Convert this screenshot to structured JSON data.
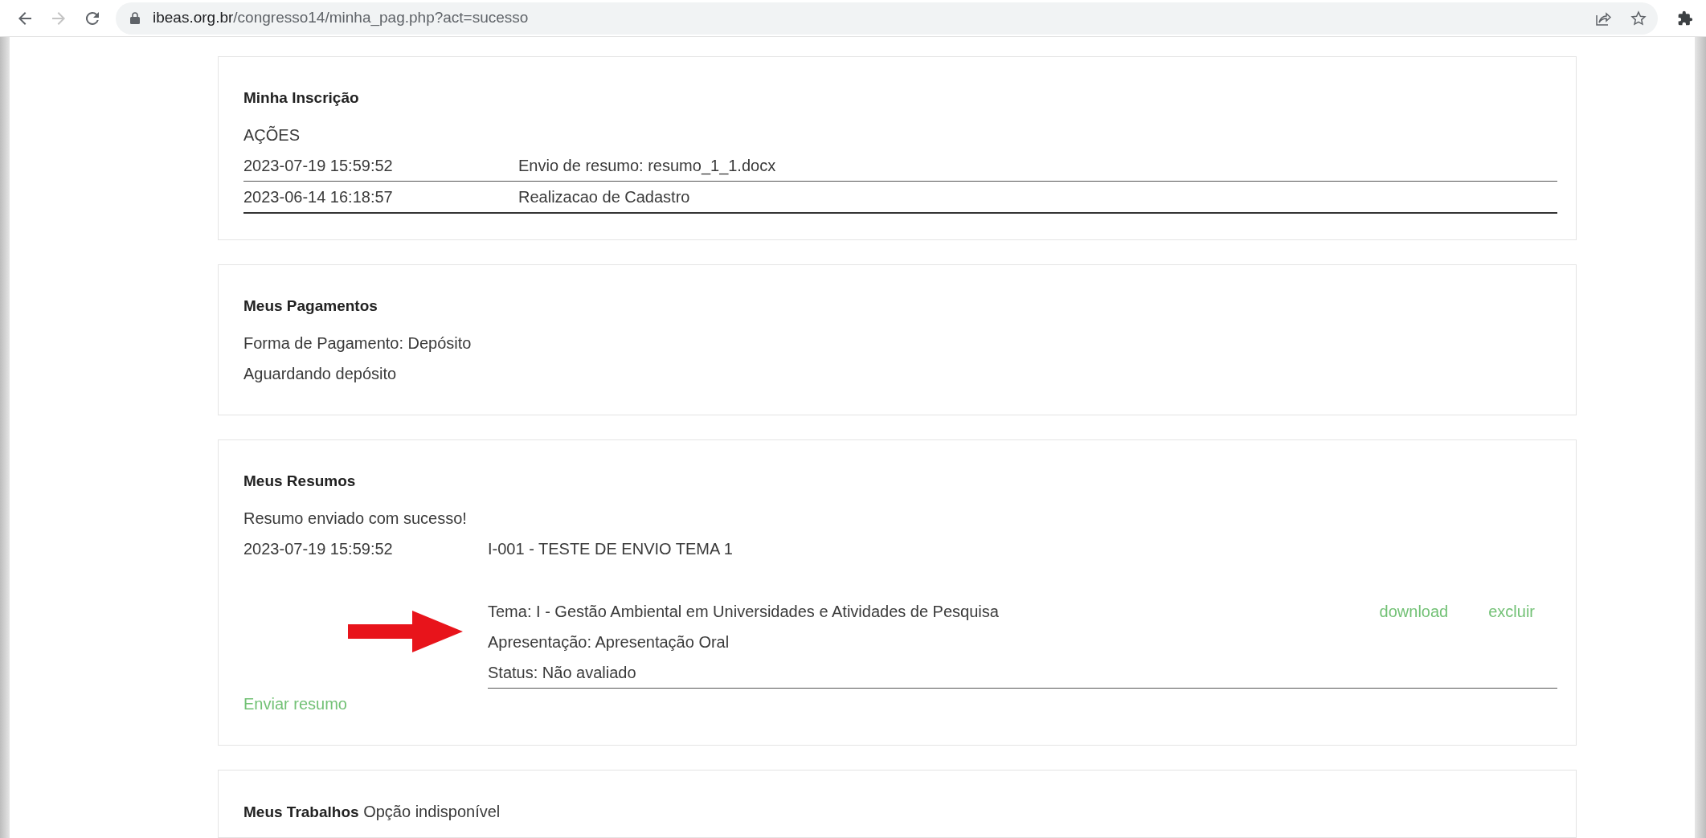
{
  "browser": {
    "nav": [
      {
        "kind": "back",
        "disabled": false
      },
      {
        "kind": "forward",
        "disabled": true
      },
      {
        "kind": "reload",
        "disabled": false
      }
    ],
    "url_host": "ibeas.org.br",
    "url_path": "/congresso14/minha_pag.php?act=sucesso"
  },
  "inscricao": {
    "title": "Minha Inscrição",
    "subtitle": "AÇÕES",
    "rows": [
      {
        "date": "2023-07-19 15:59:52",
        "action": "Envio de resumo: resumo_1_1.docx"
      },
      {
        "date": "2023-06-14 16:18:57",
        "action": "Realizacao de Cadastro"
      }
    ]
  },
  "pagamentos": {
    "title": "Meus Pagamentos",
    "lines": [
      "Forma de Pagamento: Depósito",
      "Aguardando depósito"
    ]
  },
  "resumos": {
    "title": "Meus Resumos",
    "message": "Resumo enviado com sucesso!",
    "entries": [
      {
        "date": "2023-07-19 15:59:52",
        "heading": "I-001 - TESTE DE ENVIO TEMA 1",
        "details": [
          "Tema: I - Gestão Ambiental em Universidades e Atividades de Pesquisa",
          "Apresentação: Apresentação Oral",
          "Status: Não avaliado"
        ],
        "links": [
          "download",
          "excluir"
        ]
      }
    ],
    "submit_link": "Enviar resumo"
  },
  "trabalhos": {
    "title": "Meus Trabalhos",
    "note": "Opção indisponível"
  }
}
